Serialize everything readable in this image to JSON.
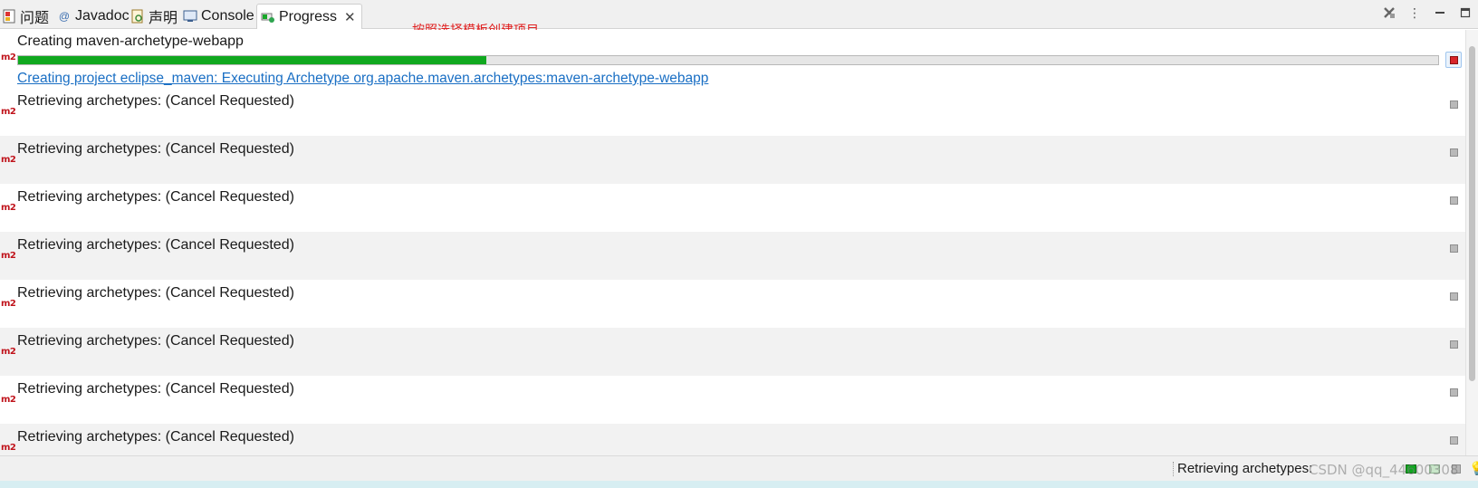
{
  "tabs": [
    {
      "label": "问题",
      "icon": "problems-icon",
      "active": false
    },
    {
      "label": "Javadoc",
      "icon": "javadoc-at-icon",
      "active": false
    },
    {
      "label": "声明",
      "icon": "declaration-icon",
      "active": false
    },
    {
      "label": "Console",
      "icon": "console-icon",
      "active": false
    },
    {
      "label": "Progress",
      "icon": "progress-icon",
      "active": true
    }
  ],
  "toolbar": {
    "remove_all_icon": "remove-all-finished-icon",
    "view_menu_icon": "view-menu-icon",
    "minimize_icon": "minimize-icon",
    "maximize_icon": "maximize-icon"
  },
  "annotation": "按照选择模板创建项目",
  "m2_badge": "m2",
  "active_job": {
    "name": "Creating maven-archetype-webapp",
    "progress_fraction": 0.33,
    "detail": "Creating project eclipse_maven: Executing Archetype org.apache.maven.archetypes:maven-archetype-webapp"
  },
  "jobs": [
    {
      "name": "Retrieving archetypes: (Cancel Requested)"
    },
    {
      "name": "Retrieving archetypes: (Cancel Requested)"
    },
    {
      "name": "Retrieving archetypes: (Cancel Requested)"
    },
    {
      "name": "Retrieving archetypes: (Cancel Requested)"
    },
    {
      "name": "Retrieving archetypes: (Cancel Requested)"
    },
    {
      "name": "Retrieving archetypes: (Cancel Requested)"
    },
    {
      "name": "Retrieving archetypes: (Cancel Requested)"
    },
    {
      "name": "Retrieving archetypes: (Cancel Requested)"
    }
  ],
  "status_bar": {
    "text": "Retrieving archetypes:",
    "watermark": "CSDN @qq_44600308"
  },
  "colors": {
    "progress_fill": "#10a81f",
    "link": "#1a6fc4",
    "annotation": "#e02020",
    "m2_badge": "#c0141c",
    "stop_active": "#d8262b"
  }
}
